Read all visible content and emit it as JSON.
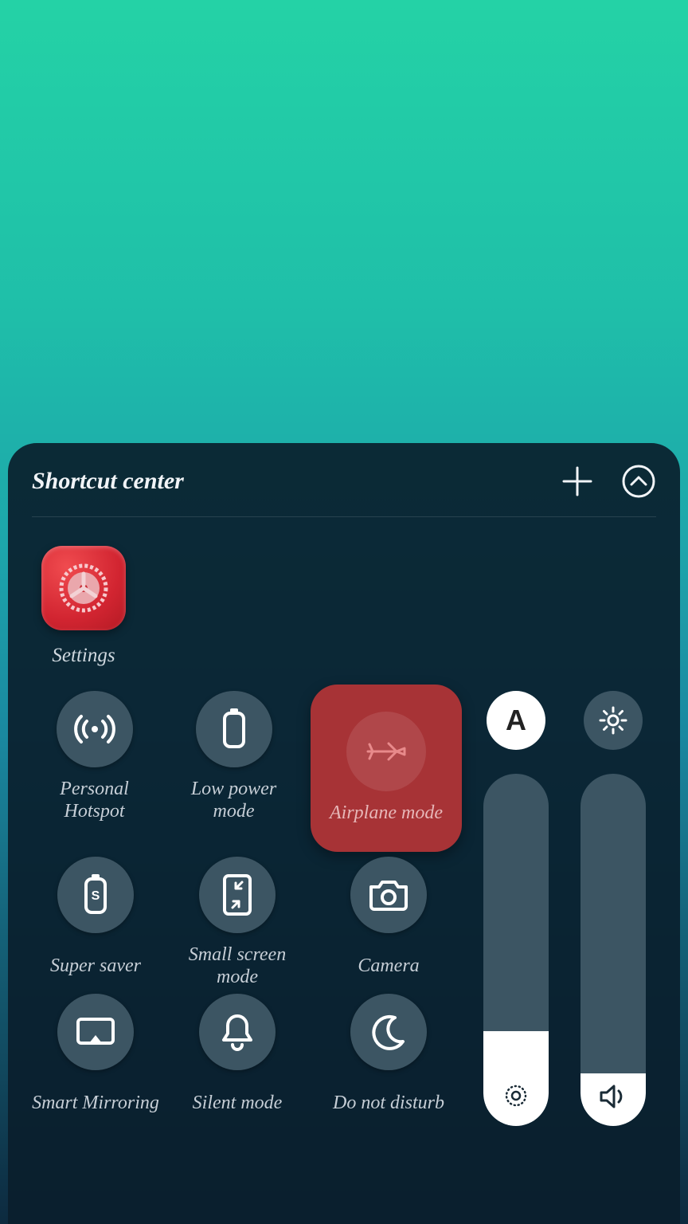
{
  "panel": {
    "title": "Shortcut center"
  },
  "apps": [
    {
      "label": "Settings"
    }
  ],
  "toggles": {
    "row1": [
      {
        "label": "Personal Hotspot"
      },
      {
        "label": "Low power mode"
      },
      {
        "label": "Airplane mode"
      }
    ],
    "row2": [
      {
        "label": "Super saver"
      },
      {
        "label": "Small screen mode"
      },
      {
        "label": "Camera"
      }
    ],
    "row3": [
      {
        "label": "Smart Mirroring"
      },
      {
        "label": "Silent mode"
      },
      {
        "label": "Do not disturb"
      }
    ]
  },
  "side": {
    "auto_label": "A",
    "brightness_percent": 27,
    "volume_percent": 15
  }
}
